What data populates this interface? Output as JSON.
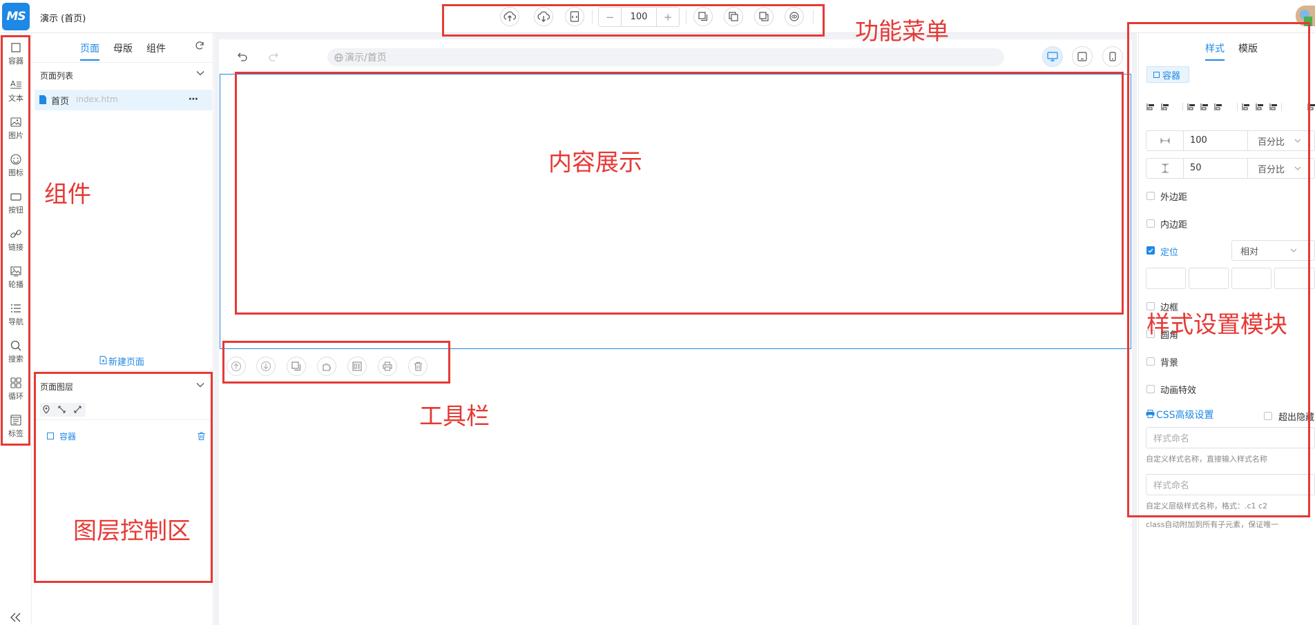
{
  "app": {
    "logo": "MS",
    "title": "演示 (首页)"
  },
  "toolbar": {
    "icons": [
      "upload-cloud-icon",
      "download-cloud-icon",
      "code-file-icon",
      "copy-icon",
      "bring-front-icon",
      "send-back-icon",
      "preview-icon"
    ],
    "zoom": {
      "minus": "−",
      "value": "100",
      "plus": "+"
    }
  },
  "components": [
    {
      "label": "容器",
      "icon": "container-icon"
    },
    {
      "label": "文本",
      "icon": "text-icon"
    },
    {
      "label": "图片",
      "icon": "image-icon"
    },
    {
      "label": "图标",
      "icon": "smiley-icon"
    },
    {
      "label": "按钮",
      "icon": "button-icon"
    },
    {
      "label": "链接",
      "icon": "link-icon"
    },
    {
      "label": "轮播",
      "icon": "carousel-icon"
    },
    {
      "label": "导航",
      "icon": "nav-list-icon"
    },
    {
      "label": "搜索",
      "icon": "search-icon"
    },
    {
      "label": "循环",
      "icon": "grid-icon"
    },
    {
      "label": "标签",
      "icon": "tag-icon"
    }
  ],
  "pages_panel": {
    "tabs": [
      "页面",
      "母版",
      "组件"
    ],
    "active_tab": "页面",
    "page_list_title": "页面列表",
    "pages": [
      {
        "name": "首页",
        "file": "index.htm"
      }
    ],
    "new_page": "新建页面",
    "layers_title": "页面图层",
    "layers": [
      {
        "name": "容器"
      }
    ]
  },
  "canvas": {
    "url": "演示/首页",
    "devices": [
      "desktop-icon",
      "tablet-icon",
      "mobile-icon"
    ],
    "active_device": "desktop-icon"
  },
  "element_toolbar": [
    "move-up-icon",
    "move-down-icon",
    "copy-icon",
    "plugin-icon",
    "template-icon",
    "print-icon",
    "delete-icon"
  ],
  "style_panel": {
    "tabs": [
      "样式",
      "模版"
    ],
    "active_tab": "样式",
    "element_badge": "容器",
    "width": {
      "value": "100",
      "unit": "百分比"
    },
    "height": {
      "value": "50",
      "unit": "百分比"
    },
    "options": [
      {
        "label": "外边距",
        "checked": false
      },
      {
        "label": "内边距",
        "checked": false
      }
    ],
    "position": {
      "label": "定位",
      "checked": true,
      "value": "相对"
    },
    "options2": [
      {
        "label": "边框",
        "checked": false
      },
      {
        "label": "圆角",
        "checked": false
      },
      {
        "label": "背景",
        "checked": false
      },
      {
        "label": "动画特效",
        "checked": false
      }
    ],
    "css_adv": {
      "title": "CSS高级设置",
      "overflow_label": "超出隐藏",
      "class_placeholder": "样式命名",
      "class_hint": "自定义样式名称，直接输入样式名称",
      "layer_placeholder": "样式命名",
      "layer_hint": "自定义层级样式名称，格式：.c1 c2",
      "layer_hint2": "class自动附加到所有子元素，保证唯一"
    }
  },
  "annotations": {
    "menu": "功能菜单",
    "components": "组件",
    "content": "内容展示",
    "toolbar": "工具栏",
    "layers": "图层控制区",
    "style": "样式设置模块"
  },
  "colors": {
    "accent": "#1e88e5",
    "annotation": "#e53935"
  }
}
